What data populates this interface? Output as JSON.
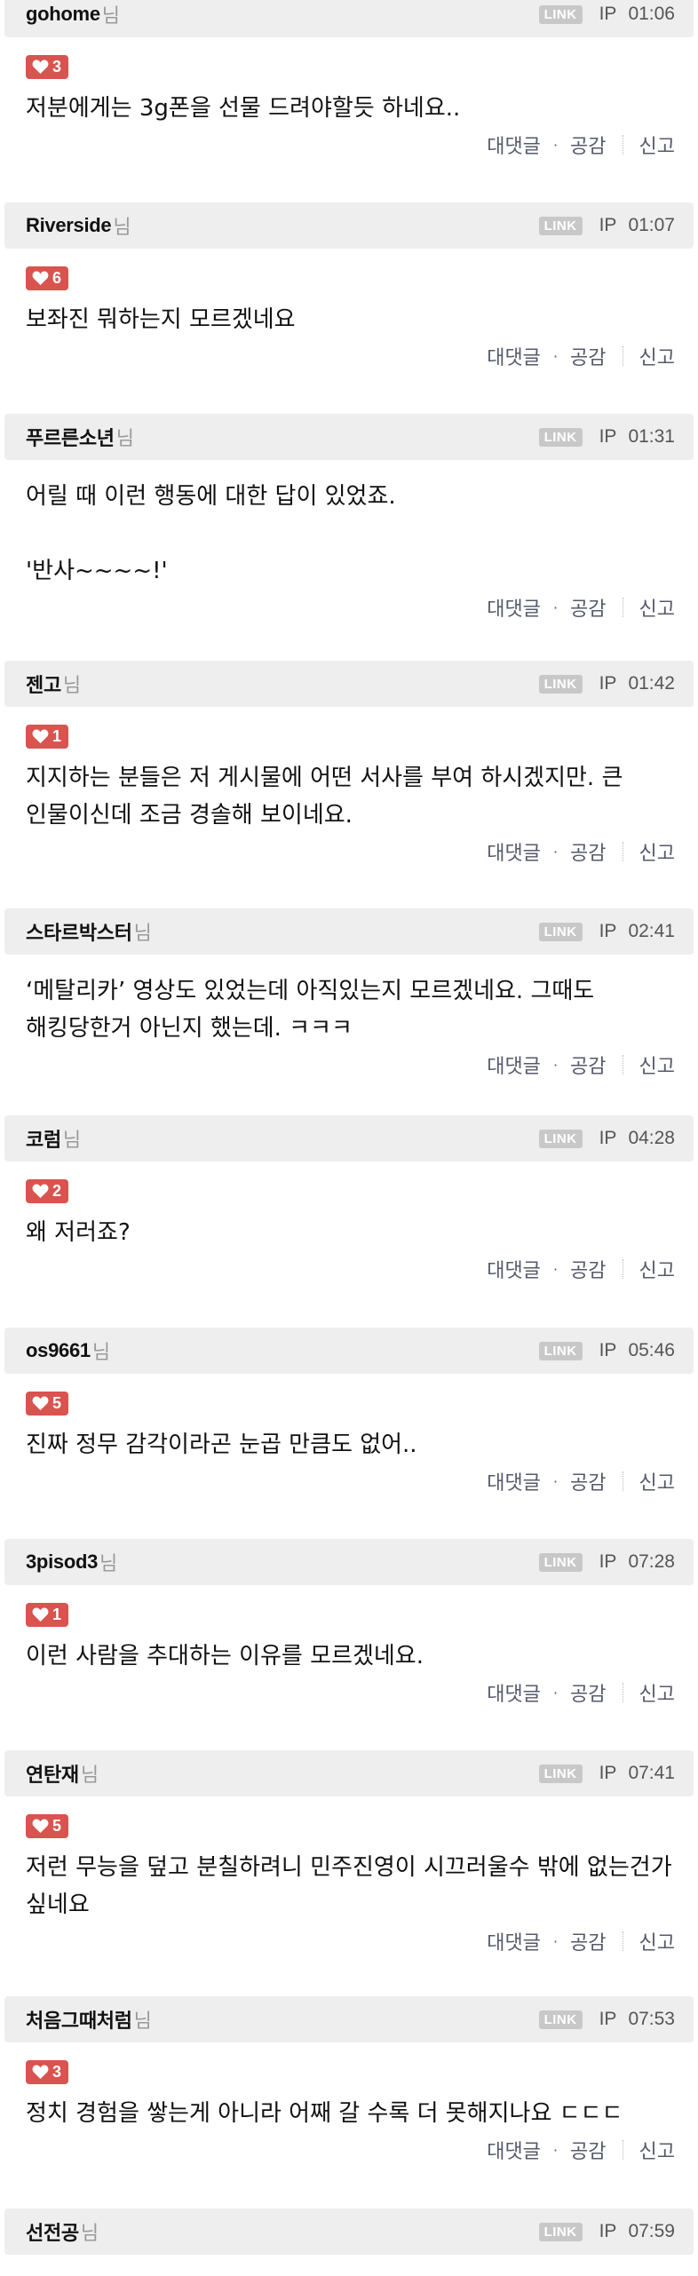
{
  "labels": {
    "nim": "님",
    "link": "LINK",
    "ip": "IP",
    "reply": "대댓글",
    "dot": "·",
    "empathy": "공감",
    "report": "신고"
  },
  "comments": [
    {
      "nick": "gohome",
      "time": "01:06",
      "likes": "3",
      "text": "저분에게는 3g폰을 선물 드려야할듯 하네요.."
    },
    {
      "nick": "Riverside",
      "time": "01:07",
      "likes": "6",
      "text": "보좌진 뭐하는지 모르겠네요"
    },
    {
      "nick": "푸르른소년",
      "time": "01:31",
      "likes": "",
      "text": "어릴 때 이런 행동에 대한 답이 있었죠.\n\n'반사~~~~!'"
    },
    {
      "nick": "젠고",
      "time": "01:42",
      "likes": "1",
      "text": "지지하는 분들은 저 게시물에 어떤 서사를 부여 하시겠지만. 큰 인물이신데 조금 경솔해 보이네요."
    },
    {
      "nick": "스타르박스터",
      "time": "02:41",
      "likes": "",
      "text": "‘메탈리카’ 영상도 있었는데 아직있는지 모르겠네요. 그때도 해킹당한거 아닌지 했는데. ㅋㅋㅋ"
    },
    {
      "nick": "코럼",
      "time": "04:28",
      "likes": "2",
      "text": "왜 저러죠?"
    },
    {
      "nick": "os9661",
      "time": "05:46",
      "likes": "5",
      "text": "진짜 정무 감각이라곤 눈곱 만큼도 없어.."
    },
    {
      "nick": "3pisod3",
      "time": "07:28",
      "likes": "1",
      "text": "이런 사람을 추대하는 이유를 모르겠네요."
    },
    {
      "nick": "연탄재",
      "time": "07:41",
      "likes": "5",
      "text": "저런 무능을 덮고 분칠하려니 민주진영이 시끄러울수 밖에 없는건가 싶네요"
    },
    {
      "nick": "처음그때처럼",
      "time": "07:53",
      "likes": "3",
      "text": "정치 경험을 쌓는게 아니라 어째 갈 수록 더 못해지나요 ㄷㄷㄷ"
    },
    {
      "nick": "선전공",
      "time": "07:59",
      "likes": "",
      "text": ""
    }
  ]
}
